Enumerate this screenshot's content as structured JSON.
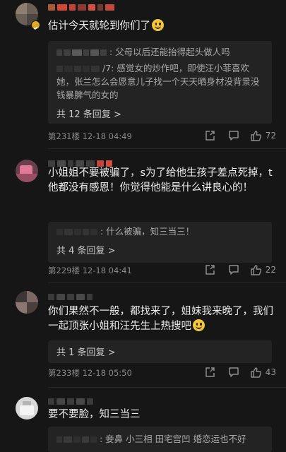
{
  "comments": [
    {
      "text": "估计今天就轮到你们了",
      "replies": [
        ": 父母以后还能抬得起头做人吗",
        "/7: 感觉女的炒作吧，即使汪小菲喜欢她，张兰怎么会愿意儿子找一个天天晒身材没背景没钱暴脾气的女的"
      ],
      "more": "共 12 条回复 >",
      "meta": "第231楼  12-18 04:49",
      "likes": "72"
    },
    {
      "text": "小姐姐不要被骗了，s为了给他生孩子差点死掉，t他都没有感恩！你觉得他能是什么讲良心的！",
      "replies": [
        ": 什么被骗，知三当三！"
      ],
      "more": "共 4 条回复 >",
      "meta": "第229楼  12-18 04:41",
      "likes": "22"
    },
    {
      "text": "你们果然不一般，都找来了，姐妹我来晚了，我们一起顶张小姐和汪先生上热搜吧",
      "more": "共 1 条回复 >",
      "meta": "第233楼  12-18 05:50",
      "likes": "43"
    },
    {
      "text": "要不要脸，知三当三",
      "replies": [
        ": 妾鼻  小三相  田宅宫凹  婚恋运也不好"
      ]
    }
  ],
  "icons": {
    "share": "share-icon",
    "comment": "comment-icon",
    "like": "thumbs-up-icon",
    "verified": "verified-badge-icon",
    "emoji": "grinning-emoji-icon"
  },
  "colors": {
    "background": "#161616",
    "reply_box": "#232323",
    "name_accent": "#e9453f"
  }
}
